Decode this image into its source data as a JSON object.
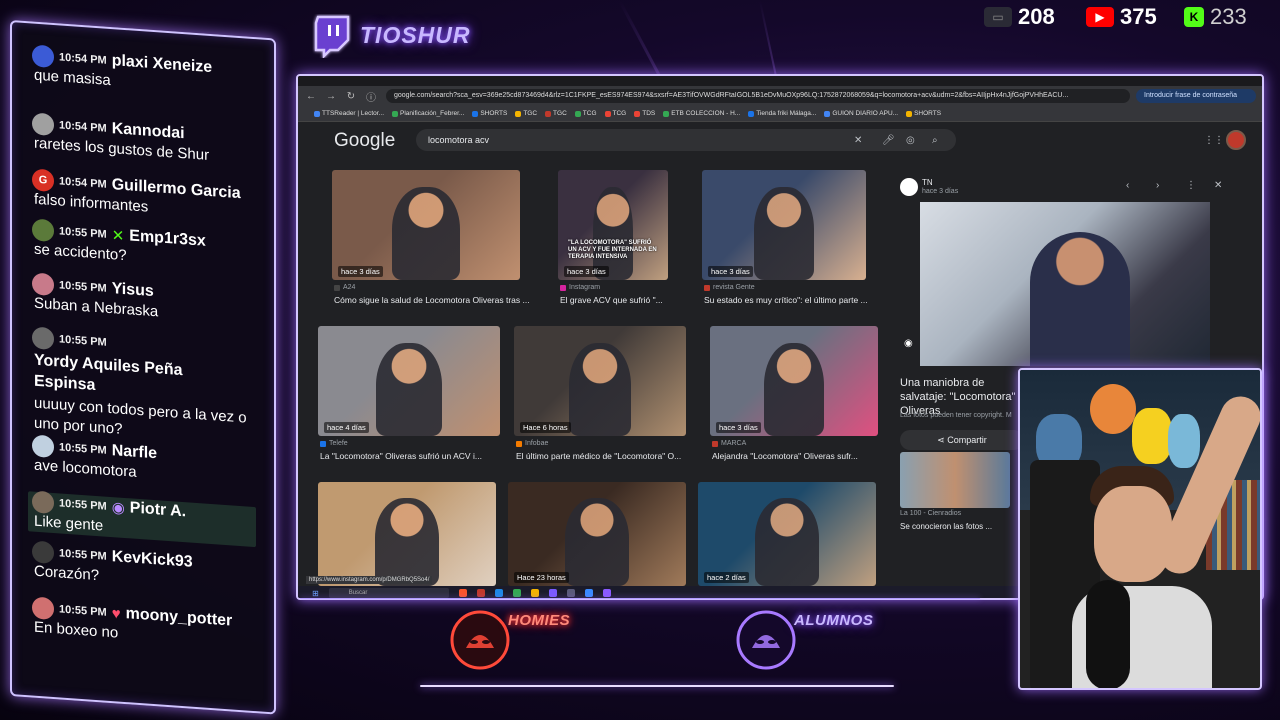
{
  "channel": {
    "name": "TIOSHUR",
    "colors": {
      "accent": "#8c5cff",
      "neon_red": "#ff3b3b"
    }
  },
  "counters": [
    {
      "icon": "kick-alt-icon",
      "value": "208",
      "color": "#2a2a35"
    },
    {
      "icon": "youtube-icon",
      "value": "375",
      "color": "#ff0000"
    },
    {
      "icon": "kick-icon",
      "value": "233",
      "color": "#53fc18"
    }
  ],
  "chat": {
    "messages": [
      {
        "time": "10:54 PM",
        "user": "plaxi Xeneize",
        "text": "que masisa",
        "avatar": "#3b5bd6"
      },
      {
        "time": "10:54 PM",
        "user": "Kannodai",
        "text": "raretes los gustos de Shur",
        "avatar": "#a0a0a0"
      },
      {
        "time": "10:54 PM",
        "user": "Guillermo Garcia",
        "text": "falso informantes",
        "avatar": "#d93025",
        "initial": "G"
      },
      {
        "time": "10:55 PM",
        "user": "Emp1r3sx",
        "text": "se accidento?",
        "avatar": "#5b7a3a",
        "badge": "✕"
      },
      {
        "time": "10:55 PM",
        "user": "Yisus",
        "text": "Suban a Nebraska",
        "avatar": "#c87a8a"
      },
      {
        "time": "10:55 PM",
        "user": "Yordy Aquiles Peña Espinsa",
        "text": "uuuuy con todos pero a la vez o uno por uno?",
        "avatar": "#6a6a6a"
      },
      {
        "time": "10:55 PM",
        "user": "Narfle",
        "text": "ave locomotora",
        "avatar": "#c0d0e0"
      },
      {
        "time": "10:55 PM",
        "user": "Piotr A.",
        "text": "Like gente",
        "avatar": "#7a6a5a",
        "badge": "◉",
        "highlight": true
      },
      {
        "time": "10:55 PM",
        "user": "KevKick93",
        "text": "Corazón?",
        "avatar": "#3a3a3a"
      },
      {
        "time": "10:55 PM",
        "user": "moony_potter",
        "text": "En boxeo no",
        "avatar": "#d07070",
        "badge": "♥"
      }
    ]
  },
  "browser": {
    "url": "google.com/search?sca_esv=369e25cd873469d4&rlz=1C1FKPE_esES974ES974&sxsrf=AE3TifOVWGdRFtaIGOL5B1eDvMuOXp96LQ:1752872068059&q=locomotora+acv&udm=2&fbs=AIIjpHx4nJjfGojPVHhEACU...",
    "url_right": "Introducir frase de contraseña",
    "bookmarks": [
      "TTSReader | Lector...",
      "Planificación_Febrer...",
      "SHORTS",
      "TGC",
      "TGC",
      "TCG",
      "TCG",
      "TDS",
      "ETB COLECCION - H...",
      "Tienda friki Málaga...",
      "GUION DIARIO APU...",
      "SHORTS"
    ],
    "search_query": "locomotora acv",
    "status_url": "https://www.instagram.com/p/DMGRbQ5So4/",
    "taskbar_search": "Buscar"
  },
  "results": [
    {
      "time": "hace 3 días",
      "source": "A24",
      "caption": "Cómo sigue la salud de Locomotora Oliveras tras ...",
      "src_color": "#444",
      "img": [
        "#7a5a4a",
        "#c09070"
      ]
    },
    {
      "time": "hace 3 días",
      "source": "Instagram",
      "caption": "El grave ACV que sufrió \"...",
      "src_color": "#d6249f",
      "img": [
        "#3a3040",
        "#c0a080"
      ],
      "overlay": "\"LA LOCOMOTORA\" SUFRIÓ UN ACV Y FUE INTERNADA EN TERAPIA INTENSIVA"
    },
    {
      "time": "hace 3 días",
      "source": "revista Gente",
      "caption": "Su estado es muy crítico\": el último parte ...",
      "src_color": "#c0392b",
      "img": [
        "#3a4a6a",
        "#d8b090"
      ]
    },
    {
      "time": "hace 4 días",
      "source": "Telefe",
      "caption": "La \"Locomotora\" Oliveras sufrió un ACV i...",
      "src_color": "#1a73e8",
      "img": [
        "#8a8a90",
        "#c09070"
      ]
    },
    {
      "time": "Hace 6 horas",
      "source": "Infobae",
      "caption": "El último parte médico de \"Locomotora\" O...",
      "src_color": "#f57c00",
      "img": [
        "#403a38",
        "#b09070"
      ]
    },
    {
      "time": "hace 3 días",
      "source": "MARCA",
      "caption": "Alejandra \"Locomotora\" Oliveras sufr...",
      "src_color": "#c0392b",
      "img": [
        "#6a7080",
        "#e05080"
      ]
    },
    {
      "time": "",
      "source": "",
      "caption": "",
      "src_color": "#444",
      "img": [
        "#c09a70",
        "#e0d0c0"
      ]
    },
    {
      "time": "Hace 23 horas",
      "source": "",
      "caption": "",
      "src_color": "#444",
      "img": [
        "#3a2a22",
        "#a07a5a"
      ]
    },
    {
      "time": "hace 2 días",
      "source": "",
      "caption": "",
      "src_color": "#444",
      "img": [
        "#1e4a6a",
        "#c0a080"
      ]
    }
  ],
  "preview": {
    "site": "TN",
    "time": "hace 3 días",
    "title": "Una maniobra de salvataje: \"Locomotora\" Oliveras",
    "copyright": "Las fotos pueden tener copyright. M",
    "share": "Compartir",
    "related_source": "La 100 - Cienradios",
    "related_caption": "Se conocieron las fotos ..."
  },
  "bottom_badges": {
    "homies": "HOMIES",
    "alumnos": "ALUMNOS"
  }
}
